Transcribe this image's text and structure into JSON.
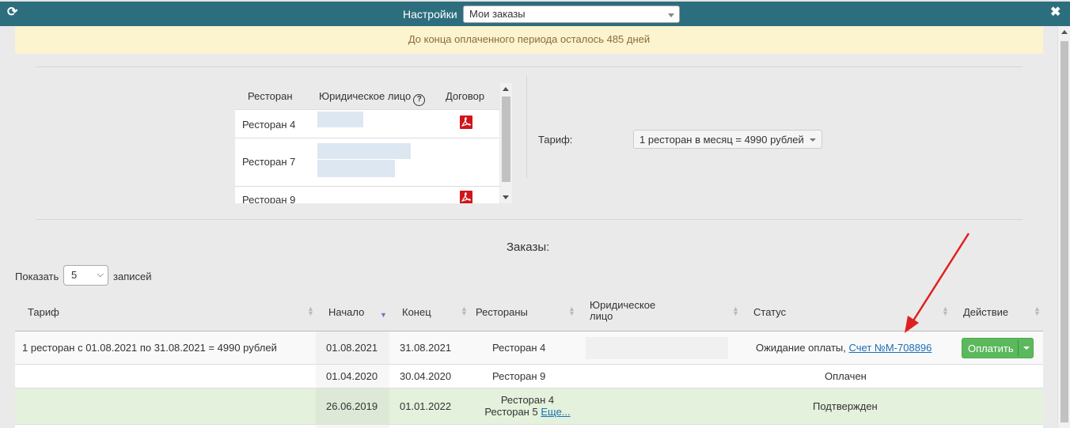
{
  "topbar": {
    "settings_label": "Настройки",
    "settings_value": "Мои заказы",
    "refresh_glyph": "⟳",
    "close_glyph": "✖"
  },
  "banner": {
    "text": "До конца оплаченного периода осталось 485 дней"
  },
  "restaurants_table": {
    "headers": [
      "Ресторан",
      "Юридическое лицо",
      "Договор"
    ],
    "help_glyph": "?",
    "rows": [
      {
        "name": "Ресторан 4",
        "has_contract": true
      },
      {
        "name": "Ресторан 7",
        "has_contract": false
      },
      {
        "name": "Ресторан 9",
        "has_contract": true
      }
    ]
  },
  "tariff": {
    "label": "Тариф:",
    "value": "1 ресторан в месяц = 4990 рублей"
  },
  "orders": {
    "title": "Заказы:",
    "show_label": "Показать",
    "page_size": "5",
    "entries_label": "записей",
    "headers": {
      "tariff": "Тариф",
      "start": "Начало",
      "end": "Конец",
      "restaurants": "Рестораны",
      "legal_line1": "Юридическое",
      "legal_line2": "лицо",
      "status": "Статус",
      "action": "Действие"
    },
    "rows": [
      {
        "tariff": "1 ресторан с 01.08.2021 по 31.08.2021 = 4990 рублей",
        "start": "01.08.2021",
        "end": "31.08.2021",
        "restaurant_line1": "Ресторан 4",
        "status": "Ожидание оплаты,",
        "status_link": "Счет №M-708896",
        "action": "Оплатить"
      },
      {
        "tariff": "",
        "start": "01.04.2020",
        "end": "30.04.2020",
        "restaurant_line1": "Ресторан 9",
        "status": "Оплачен"
      },
      {
        "tariff": "",
        "start": "26.06.2019",
        "end": "01.01.2022",
        "restaurant_line1": "Ресторан 4",
        "restaurant_line2": "Ресторан 5",
        "more_link": "Еще...",
        "status": "Подтвержден"
      }
    ]
  },
  "colors": {
    "topbar": "#2d6e7e",
    "banner_bg": "#fcf3cf",
    "banner_text": "#8a6d3b",
    "confirmed_row": "#e4f1dc",
    "pay_button": "#5cb85c",
    "link": "#1a6fb5",
    "pdf_icon": "#d0151b",
    "arrow": "#e02020"
  },
  "icons": {
    "refresh": "refresh-icon",
    "close": "close-icon",
    "help": "help-icon",
    "contract": "pdf-icon",
    "sort": "sort-icon"
  }
}
